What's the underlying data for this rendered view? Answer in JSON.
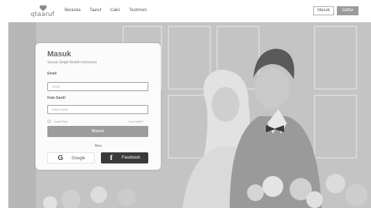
{
  "brand": {
    "name": "qtaaruf",
    "icon": "heart-icon"
  },
  "nav": [
    "Beranda",
    "Taaruf",
    "Cakri",
    "Testimoni"
  ],
  "header_buttons": {
    "login": "Masuk",
    "register": "Daftar"
  },
  "login_card": {
    "title": "Masuk",
    "subtitle": "Sesuai Single Muslim Indonesia",
    "email_label": "Email",
    "email_placeholder": "Email",
    "password_label": "Kata Sandi",
    "password_placeholder": "Kata Sandi",
    "remember_label": "Ingat Saya",
    "forgot_label": "Lupa Sandi?",
    "submit_label": "Masuk",
    "divider_label": "Atau",
    "google_label": "Google",
    "facebook_label": "Facebook"
  },
  "colors": {
    "primary_button": "#9c9c9c",
    "facebook_button": "#3a3a3a",
    "background": "#bdbdbd"
  }
}
